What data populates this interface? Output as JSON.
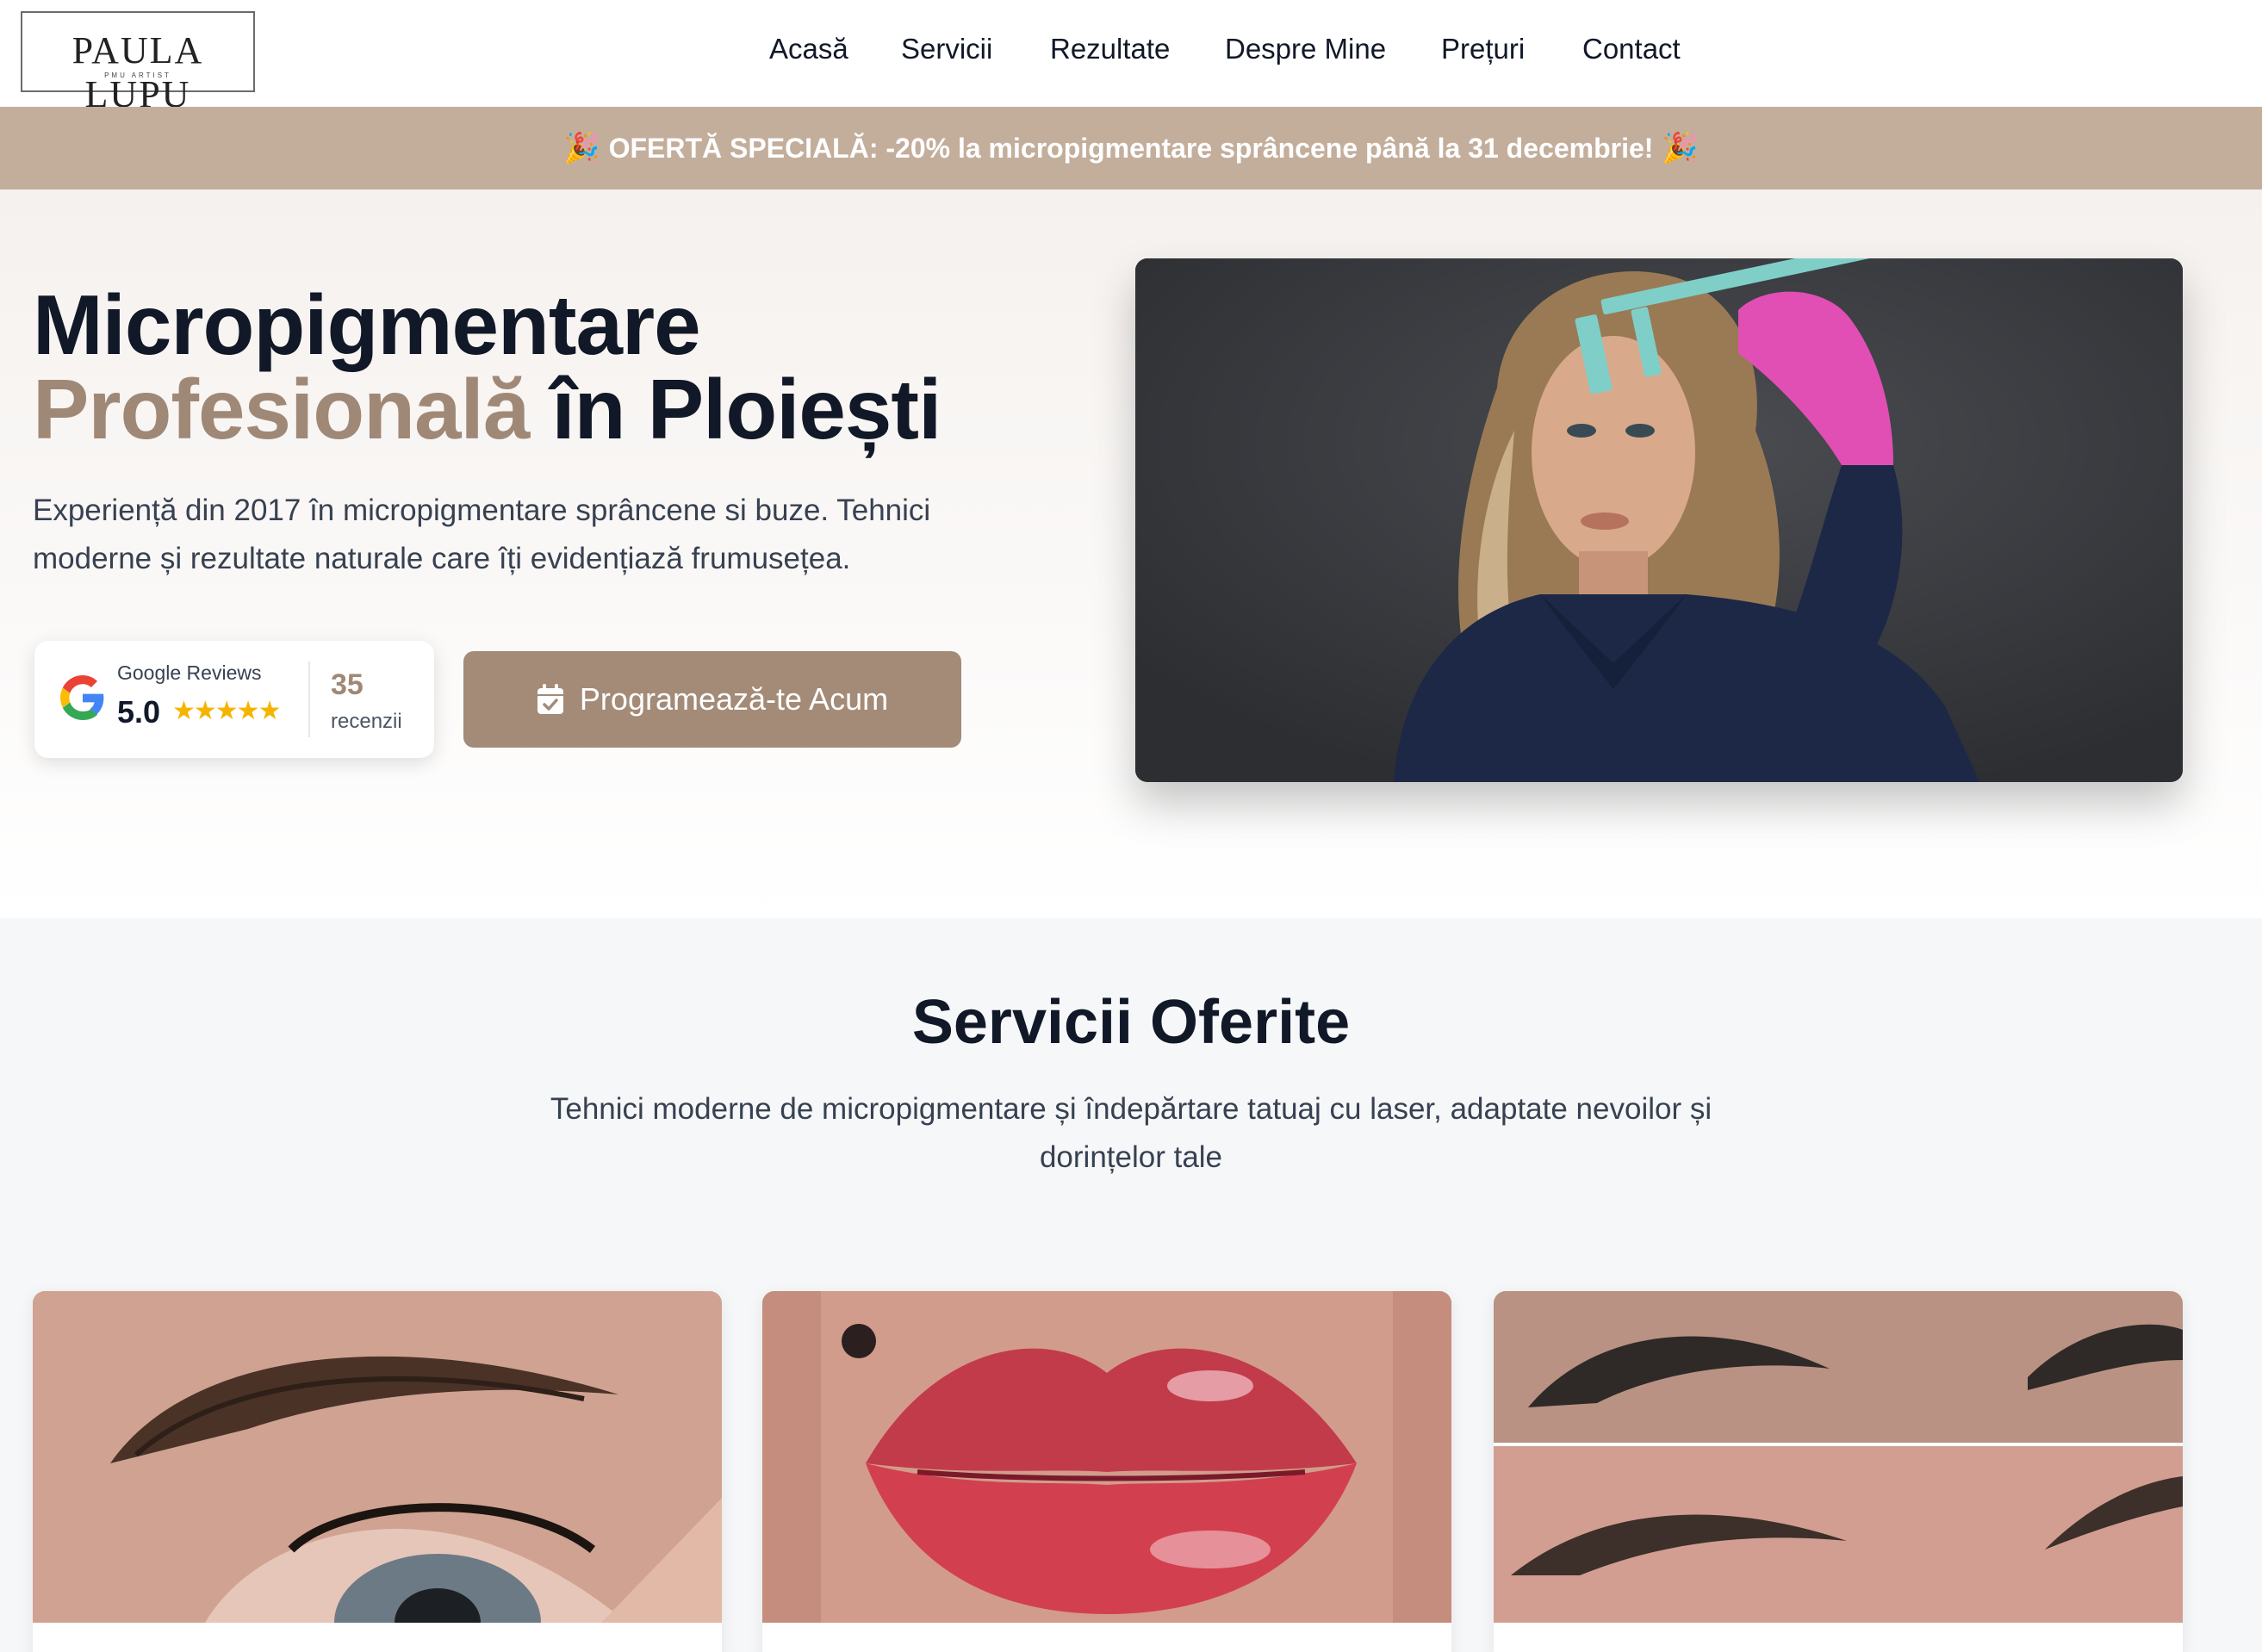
{
  "header": {
    "logo": {
      "name": "PAULA LUPU",
      "tagline": "PMU ARTIST"
    },
    "nav": [
      "Acasă",
      "Servicii",
      "Rezultate",
      "Despre Mine",
      "Prețuri",
      "Contact"
    ]
  },
  "promo": {
    "text": "OFERTĂ SPECIALĂ: -20% la micropigmentare sprâncene până la 31 decembrie!",
    "icon": "party-popper-icon"
  },
  "hero": {
    "title_line1": "Micropigmentare",
    "title_accent": "Profesională",
    "title_rest": " în Ploiești",
    "description": "Experiență din 2017 în micropigmentare sprâncene si buze. Tehnici moderne și rezultate naturale care îți evidențiază frumusețea.",
    "reviews": {
      "label": "Google Reviews",
      "score": "5.0",
      "stars": "★★★★★",
      "rating": 5,
      "count": "35",
      "count_label": "recenzii"
    },
    "cta_label": "Programează-te Acum"
  },
  "services": {
    "title": "Servicii Oferite",
    "subtitle": "Tehnici moderne de micropigmentare și îndepărtare tatuaj cu laser, adaptate nevoilor și dorințelor tale"
  },
  "colors": {
    "accent": "#a08877",
    "promo_bg": "#c3ae9c",
    "cta_bg": "#a38b78",
    "star": "#f5b400",
    "text": "#111827"
  }
}
